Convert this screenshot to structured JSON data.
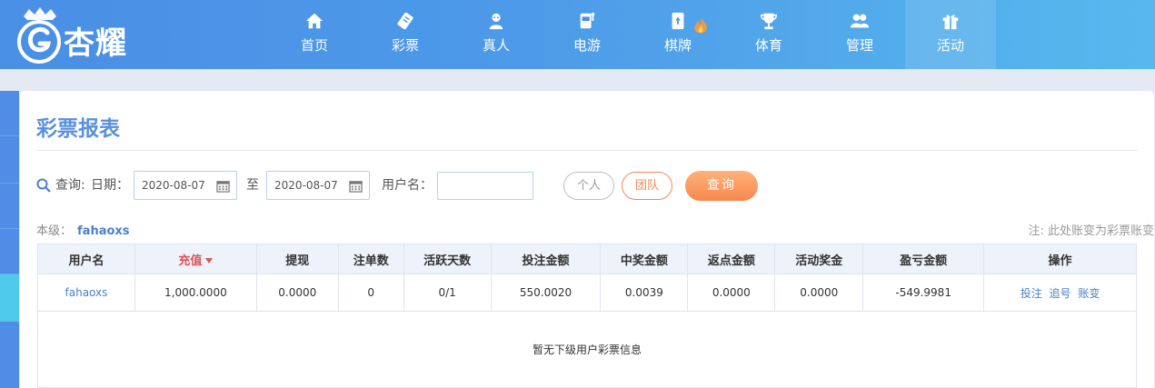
{
  "brand": {
    "name": "杏耀"
  },
  "nav": [
    {
      "label": "首页",
      "icon": "home-icon"
    },
    {
      "label": "彩票",
      "icon": "lottery-ticket-icon"
    },
    {
      "label": "真人",
      "icon": "live-dealer-icon"
    },
    {
      "label": "电游",
      "icon": "slot-machine-icon"
    },
    {
      "label": "棋牌",
      "icon": "cards-icon"
    },
    {
      "label": "体育",
      "icon": "trophy-icon"
    },
    {
      "label": "管理",
      "icon": "users-icon"
    },
    {
      "label": "活动",
      "icon": "gift-icon"
    }
  ],
  "page": {
    "title": "彩票报表"
  },
  "query": {
    "query_label": "查询:",
    "date_label": "日期：",
    "date_from": "2020-08-07",
    "to_label": "至",
    "date_to": "2020-08-07",
    "username_label": "用户名：",
    "username_value": "",
    "personal_label": "个人",
    "team_label": "团队",
    "submit_label": "查询"
  },
  "level": {
    "label": "本级：",
    "name": "fahaoxs"
  },
  "note": "注: 此处账变为彩票账变",
  "table": {
    "headers": [
      "用户名",
      "充值",
      "提现",
      "注单数",
      "活跃天数",
      "投注金额",
      "中奖金额",
      "返点金额",
      "活动奖金",
      "盈亏金额",
      "操作"
    ],
    "row": {
      "username": "fahaoxs",
      "recharge": "1,000.0000",
      "withdraw": "0.0000",
      "bet_count": "0",
      "active_days": "0/1",
      "bet_amount": "550.0020",
      "win_amount": "0.0039",
      "rebate_amount": "0.0000",
      "activity_bonus": "0.0000",
      "profit_loss": "-549.9981",
      "ops": [
        "投注",
        "追号",
        "账变"
      ]
    },
    "empty_message": "暂无下级用户彩票信息"
  },
  "colors": {
    "accent": "#5a90dd",
    "nav_gradient_start": "#4a8fe6",
    "nav_gradient_end": "#57b8ee",
    "query_button": "#f7884c",
    "negative": "#e04040"
  }
}
